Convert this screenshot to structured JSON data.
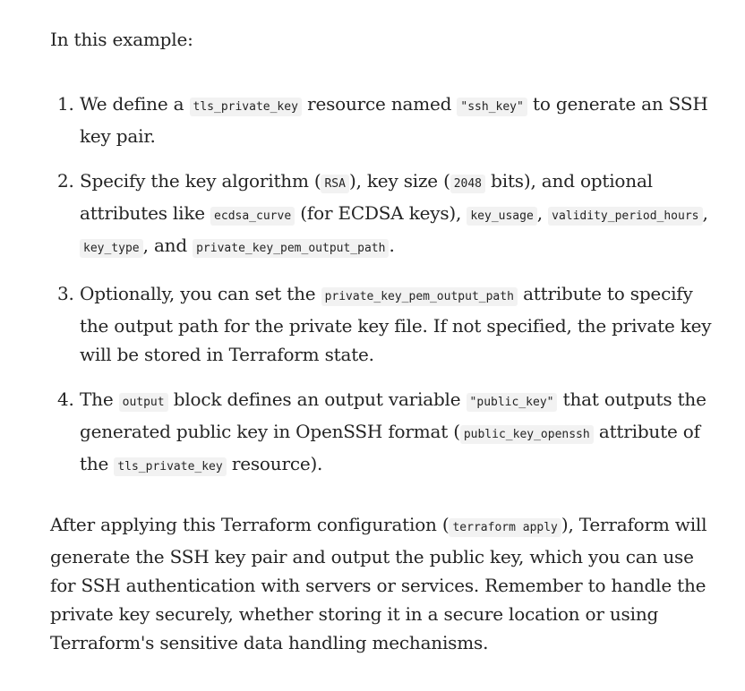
{
  "intro": "In this example:",
  "steps": [
    {
      "num": "1.",
      "t1": "We define a ",
      "c1": "tls_private_key",
      "t2": " resource named ",
      "c2": "\"ssh_key\"",
      "t3": " to generate an SSH key pair."
    },
    {
      "num": "2.",
      "t1": "Specify the key algorithm (",
      "c1": "RSA",
      "t2": "), key size (",
      "c2": "2048",
      "t3": " bits), and optional attributes like ",
      "c3": "ecdsa_curve",
      "t4": " (for ECDSA keys), ",
      "c4": "key_usage",
      "t5": ", ",
      "c5": "validity_period_hours",
      "t6": ", ",
      "c6": "key_type",
      "t7": ", and ",
      "c7": "private_key_pem_output_path",
      "t8": "."
    },
    {
      "num": "3.",
      "t1": "Optionally, you can set the ",
      "c1": "private_key_pem_output_path",
      "t2": " attribute to specify the output path for the private key file. If not specified, the private key will be stored in Terraform state."
    },
    {
      "num": "4.",
      "t1": "The ",
      "c1": "output",
      "t2": " block defines an output variable ",
      "c2": "\"public_key\"",
      "t3": " that outputs the generated public key in OpenSSH format (",
      "c3": "public_key_openssh",
      "t4": " attribute of the ",
      "c4": "tls_private_key",
      "t5": " resource)."
    }
  ],
  "outro": {
    "t1": "After applying this Terraform configuration (",
    "c1": "terraform apply",
    "t2": "), Terraform will generate the SSH key pair and output the public key, which you can use for SSH authentication with servers or services. Remember to handle the private key securely, whether storing it in a secure location or using Terraform's sensitive data handling mechanisms."
  }
}
